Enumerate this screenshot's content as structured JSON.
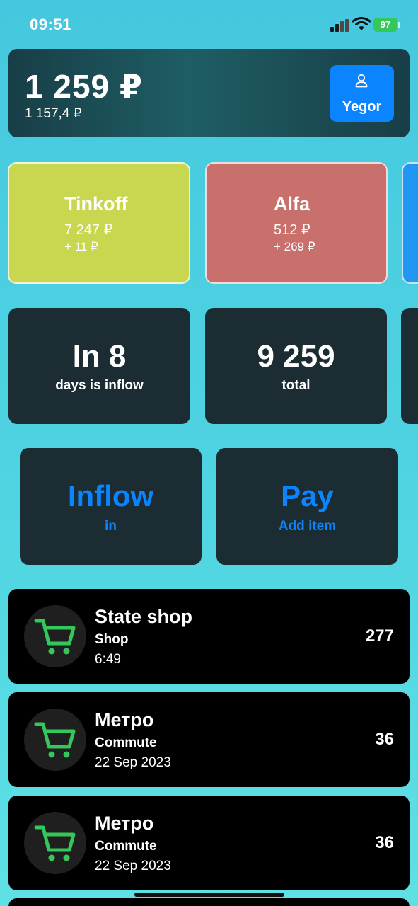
{
  "status_bar": {
    "time": "09:51",
    "battery": "97"
  },
  "header": {
    "balance": "1 259 ₽",
    "balance_sub": "1 157,4 ₽",
    "user_button": {
      "label": "Yegor",
      "icon": "person-icon"
    }
  },
  "accounts": [
    {
      "name": "Tinkoff",
      "amount": "7 247 ₽",
      "delta": "+ 11 ₽",
      "color": "#c9d64f"
    },
    {
      "name": "Alfa",
      "amount": "512 ₽",
      "delta": "+ 269 ₽",
      "color": "#c9706c"
    }
  ],
  "stats": [
    {
      "big": "In 8",
      "small": "days is inflow"
    },
    {
      "big": "9 259",
      "small": "total"
    }
  ],
  "actions": [
    {
      "big": "Inflow",
      "small": "in"
    },
    {
      "big": "Pay",
      "small": "Add item"
    }
  ],
  "transactions": [
    {
      "title": "State shop",
      "category": "Shop",
      "date": "6:49",
      "amount": "277",
      "icon": "cart-icon"
    },
    {
      "title": "Метро",
      "category": "Commute",
      "date": "22 Sep 2023",
      "amount": "36",
      "icon": "cart-icon"
    },
    {
      "title": "Метро",
      "category": "Commute",
      "date": "22 Sep 2023",
      "amount": "36",
      "icon": "cart-icon"
    }
  ],
  "colors": {
    "accent": "#0a84ff",
    "cart": "#34c759",
    "card_dark": "#1b2d32"
  }
}
